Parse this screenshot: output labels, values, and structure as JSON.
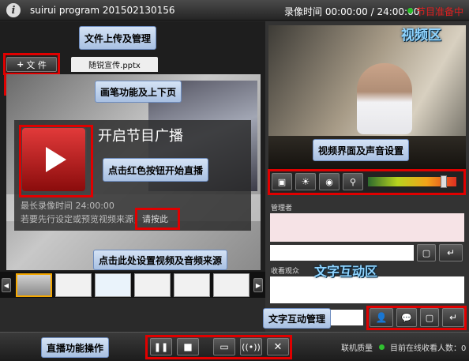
{
  "titlebar": {
    "app_title": "suirui program 201502130156",
    "record_label": "录像时间",
    "record_elapsed": "00:00:00",
    "record_sep": "/",
    "record_total": "24:00:00",
    "status_text": "节目准备中",
    "status_color": "#e02020"
  },
  "toolbar": {
    "file_button": "文 件",
    "file_tab": "随锐宣传.pptx"
  },
  "slide": {
    "title": "开启节目广播",
    "max_record": "最长录像时间 24:00:00",
    "preview_hint": "若要先行设定或预览视频来源，",
    "press_here": "请按此"
  },
  "right_panel": {
    "host_label": "管理者",
    "audience_label": "收看观众",
    "volume_level": 0.88
  },
  "bottom": {
    "link_quality": "联机质量",
    "online_count": "目前在线收看人数：0"
  },
  "annotations": {
    "file_upload": "文件上传及管理",
    "pen_function": "画笔功能及上下页",
    "video_area": "视频区",
    "video_settings": "视频界面及声音设置",
    "red_button": "点击红色按钮开始直播",
    "set_source": "点击此处设置视频及音频来源",
    "text_area": "文字互动区",
    "text_manage": "文字互动管理",
    "live_ops": "直播功能操作"
  }
}
